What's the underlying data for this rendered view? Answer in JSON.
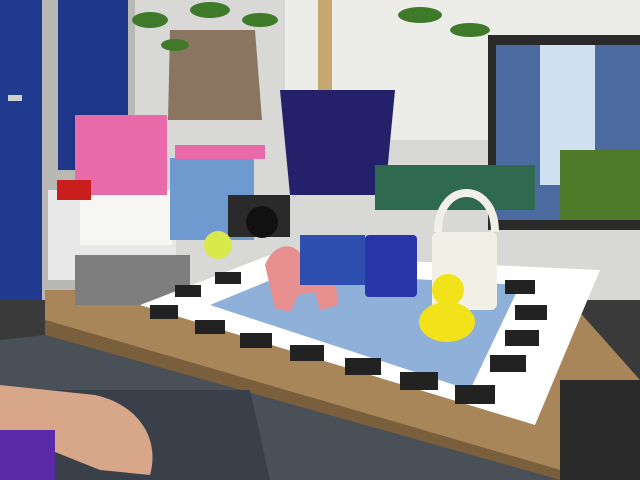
{
  "scene": {
    "description_free": true,
    "colors": {
      "wall": "#dcdcdc",
      "door_blue": "#1f3a8f",
      "desk_top": "#b08a5a",
      "mat_border": "#ffffff",
      "marker_black": "#222222",
      "pot_blue": "#25206a",
      "foam_pink": "#e86aa8",
      "duck_yellow": "#f2e21a",
      "toy_pink": "#e88f8f",
      "can_white": "#f2f0e6",
      "mug_blue": "#2a36a8",
      "floor": "#4a5058"
    }
  }
}
